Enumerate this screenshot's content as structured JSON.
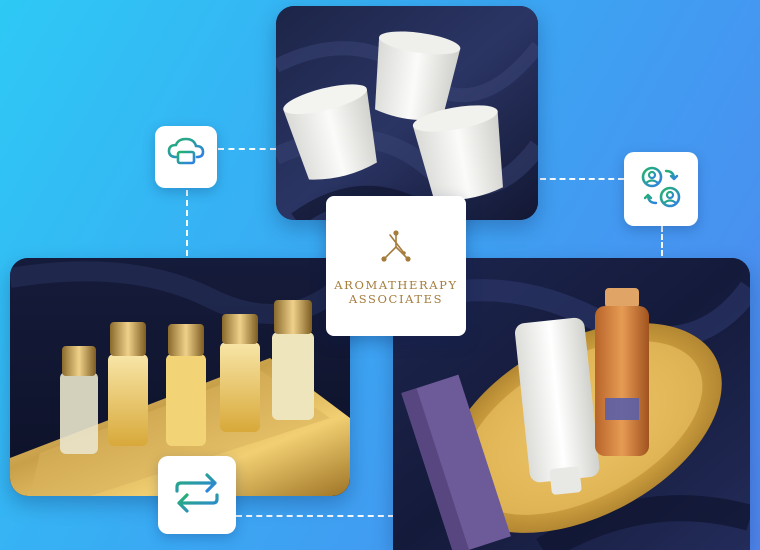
{
  "brand": {
    "line1": "AROMATHERAPY",
    "line2": "ASSOCIATES",
    "color": "#a57c3c"
  },
  "icons": {
    "cloud_monitor": "cloud-monitor-icon",
    "user_swap": "user-swap-icon",
    "sync_arrows": "sync-arrows-icon"
  },
  "colors": {
    "background_start": "#2ec9f5",
    "background_end": "#4f86ee",
    "icon_green": "#24b36b",
    "icon_blue": "#2f7fe8"
  }
}
